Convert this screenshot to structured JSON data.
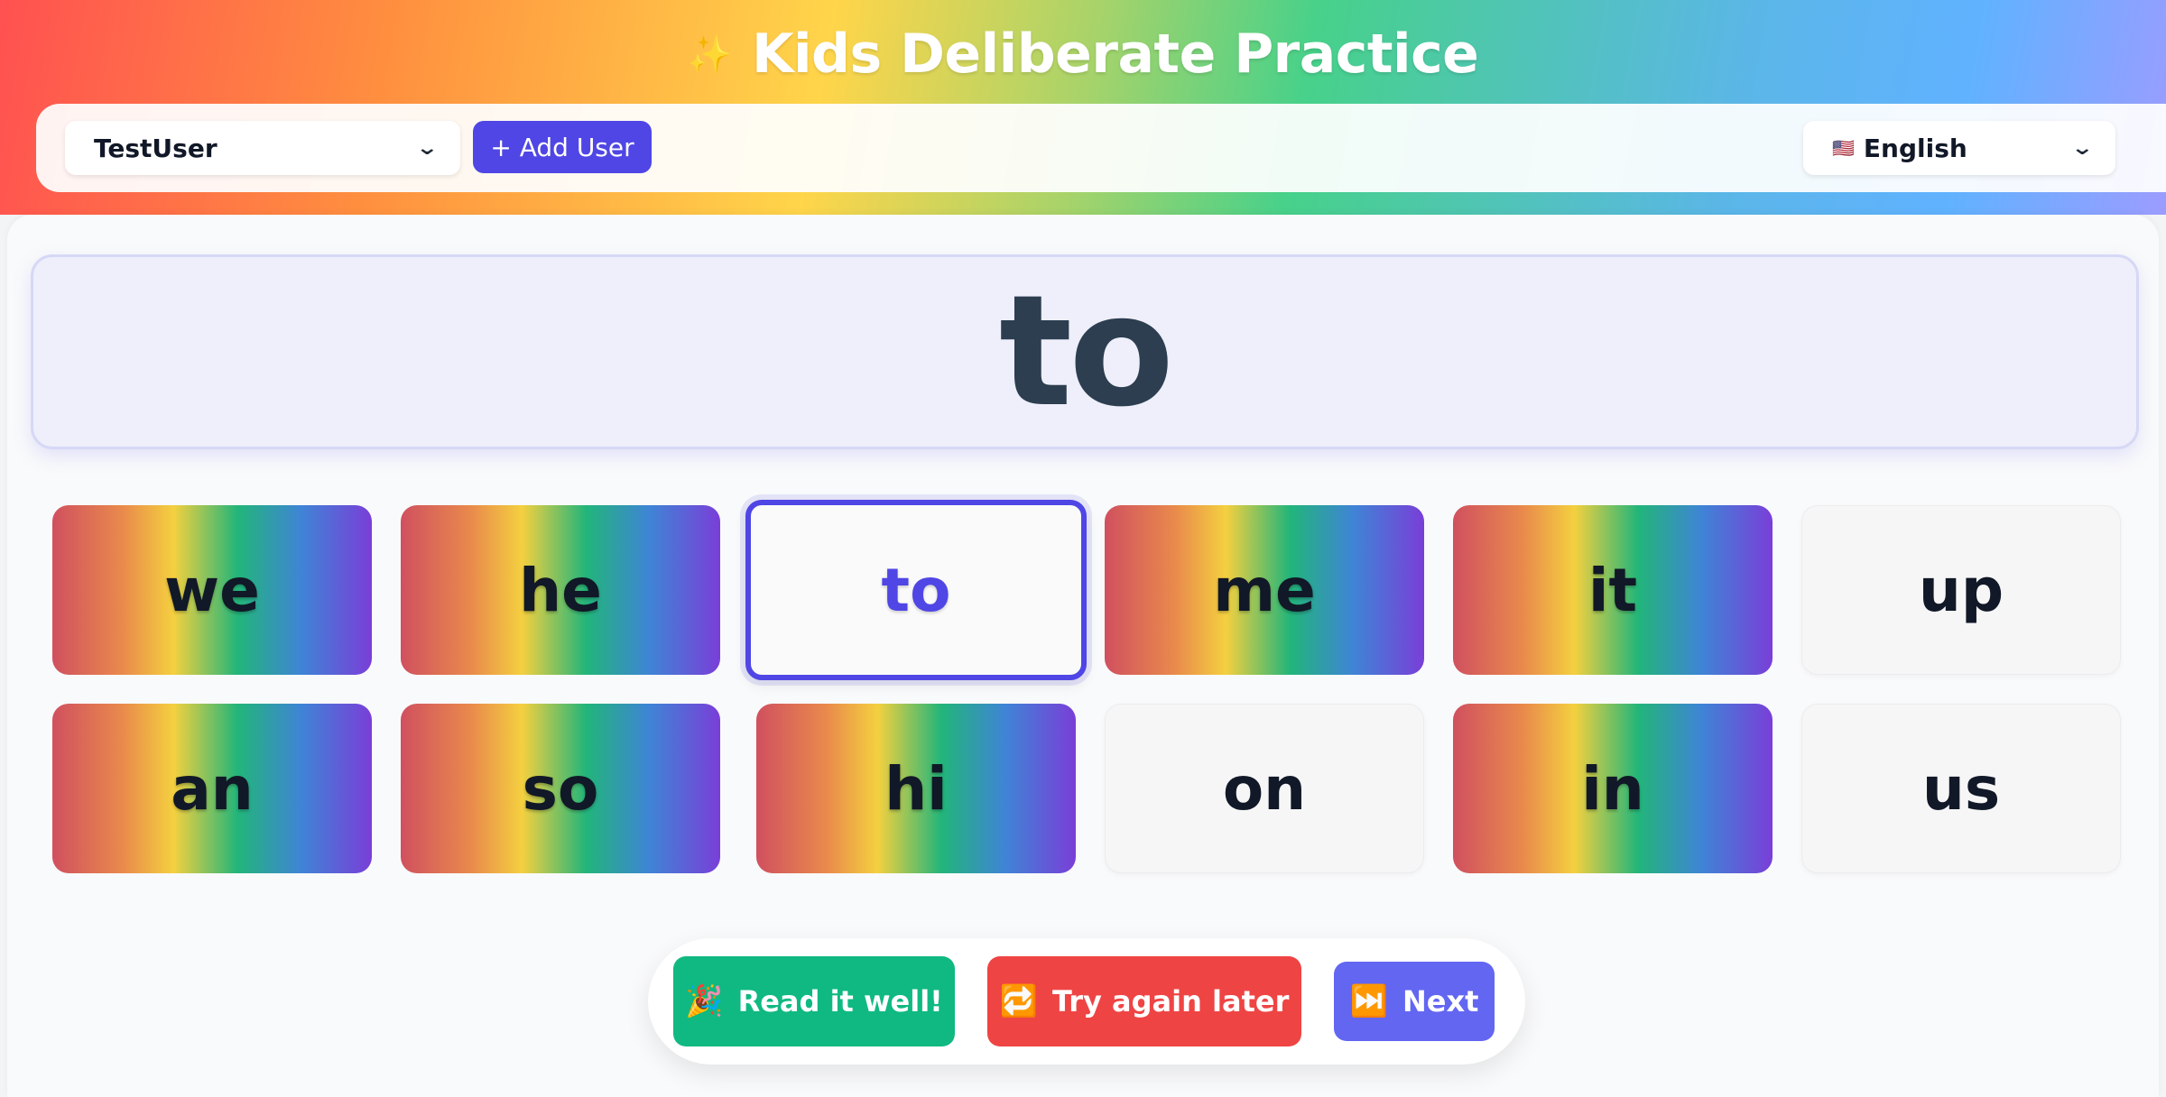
{
  "header": {
    "sparkle_icon": "✨",
    "title": "Kids Deliberate Practice"
  },
  "controls": {
    "user_select": {
      "value": "TestUser"
    },
    "add_user_label": "+ Add User",
    "language_select": {
      "flag": "🇺🇸",
      "value": "English"
    }
  },
  "current_word": "to",
  "words": [
    {
      "label": "we",
      "style": "rainbow"
    },
    {
      "label": "he",
      "style": "rainbow"
    },
    {
      "label": "to",
      "style": "selected"
    },
    {
      "label": "me",
      "style": "rainbow"
    },
    {
      "label": "it",
      "style": "rainbow"
    },
    {
      "label": "up",
      "style": "plain"
    },
    {
      "label": "an",
      "style": "rainbow"
    },
    {
      "label": "so",
      "style": "rainbow"
    },
    {
      "label": "hi",
      "style": "rainbow"
    },
    {
      "label": "on",
      "style": "plain"
    },
    {
      "label": "in",
      "style": "rainbow"
    },
    {
      "label": "us",
      "style": "plain"
    }
  ],
  "actions": {
    "read_well": {
      "icon": "🎉",
      "label": "Read it well!"
    },
    "try_again": {
      "icon": "🔁",
      "label": "Try again later"
    },
    "next": {
      "icon": "⏭️",
      "label": "Next"
    }
  },
  "colors": {
    "accent": "#4f46e5",
    "success": "#10b981",
    "danger": "#ef4444",
    "next": "#6366f1",
    "word_text": "#2c3e50"
  }
}
